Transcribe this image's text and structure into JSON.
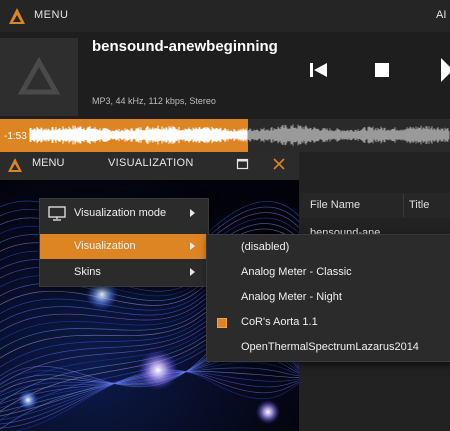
{
  "main_window": {
    "menu_label": "MENU",
    "right_label": "AI",
    "track_title": "bensound-anewbeginning",
    "track_info": "MP3, 44 kHz, 112 kbps, Stereo",
    "time_elapsed": "-1:53",
    "progress": 0.55
  },
  "vis_window": {
    "menu_label": "MENU",
    "title": "VISUALIZATION"
  },
  "playlist": {
    "columns": [
      "File Name",
      "Title"
    ],
    "row_peek": "bensound-ane"
  },
  "context_menu": {
    "items": [
      {
        "label": "Visualization mode",
        "icon": "monitor-icon"
      },
      {
        "label": "Visualization",
        "highlighted": true
      },
      {
        "label": "Skins"
      }
    ]
  },
  "sub_menu": {
    "items": [
      {
        "label": "(disabled)"
      },
      {
        "label": "Analog Meter - Classic"
      },
      {
        "label": "Analog Meter - Night"
      },
      {
        "label": "CoR's Aorta 1.1",
        "selected": true
      },
      {
        "label": "OpenThermalSpectrumLazarus2014"
      }
    ]
  },
  "colors": {
    "accent": "#dd8523",
    "background": "#1c1c1c",
    "menu_bg": "#2b2b2b"
  }
}
